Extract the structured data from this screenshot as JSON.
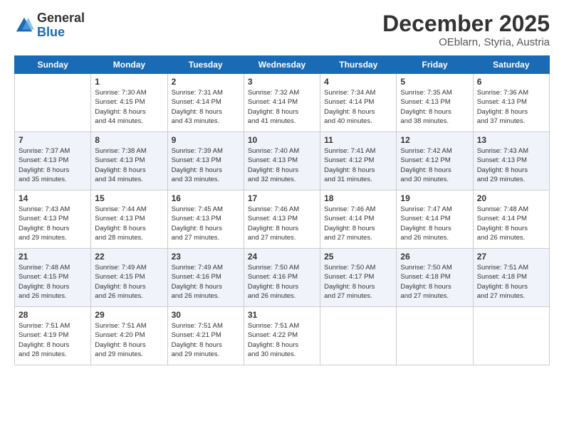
{
  "logo": {
    "general": "General",
    "blue": "Blue"
  },
  "header": {
    "month": "December 2025",
    "location": "OEblarn, Styria, Austria"
  },
  "weekdays": [
    "Sunday",
    "Monday",
    "Tuesday",
    "Wednesday",
    "Thursday",
    "Friday",
    "Saturday"
  ],
  "weeks": [
    [
      {
        "day": "",
        "info": ""
      },
      {
        "day": "1",
        "info": "Sunrise: 7:30 AM\nSunset: 4:15 PM\nDaylight: 8 hours\nand 44 minutes."
      },
      {
        "day": "2",
        "info": "Sunrise: 7:31 AM\nSunset: 4:14 PM\nDaylight: 8 hours\nand 43 minutes."
      },
      {
        "day": "3",
        "info": "Sunrise: 7:32 AM\nSunset: 4:14 PM\nDaylight: 8 hours\nand 41 minutes."
      },
      {
        "day": "4",
        "info": "Sunrise: 7:34 AM\nSunset: 4:14 PM\nDaylight: 8 hours\nand 40 minutes."
      },
      {
        "day": "5",
        "info": "Sunrise: 7:35 AM\nSunset: 4:13 PM\nDaylight: 8 hours\nand 38 minutes."
      },
      {
        "day": "6",
        "info": "Sunrise: 7:36 AM\nSunset: 4:13 PM\nDaylight: 8 hours\nand 37 minutes."
      }
    ],
    [
      {
        "day": "7",
        "info": "Sunrise: 7:37 AM\nSunset: 4:13 PM\nDaylight: 8 hours\nand 35 minutes."
      },
      {
        "day": "8",
        "info": "Sunrise: 7:38 AM\nSunset: 4:13 PM\nDaylight: 8 hours\nand 34 minutes."
      },
      {
        "day": "9",
        "info": "Sunrise: 7:39 AM\nSunset: 4:13 PM\nDaylight: 8 hours\nand 33 minutes."
      },
      {
        "day": "10",
        "info": "Sunrise: 7:40 AM\nSunset: 4:13 PM\nDaylight: 8 hours\nand 32 minutes."
      },
      {
        "day": "11",
        "info": "Sunrise: 7:41 AM\nSunset: 4:12 PM\nDaylight: 8 hours\nand 31 minutes."
      },
      {
        "day": "12",
        "info": "Sunrise: 7:42 AM\nSunset: 4:12 PM\nDaylight: 8 hours\nand 30 minutes."
      },
      {
        "day": "13",
        "info": "Sunrise: 7:43 AM\nSunset: 4:13 PM\nDaylight: 8 hours\nand 29 minutes."
      }
    ],
    [
      {
        "day": "14",
        "info": "Sunrise: 7:43 AM\nSunset: 4:13 PM\nDaylight: 8 hours\nand 29 minutes."
      },
      {
        "day": "15",
        "info": "Sunrise: 7:44 AM\nSunset: 4:13 PM\nDaylight: 8 hours\nand 28 minutes."
      },
      {
        "day": "16",
        "info": "Sunrise: 7:45 AM\nSunset: 4:13 PM\nDaylight: 8 hours\nand 27 minutes."
      },
      {
        "day": "17",
        "info": "Sunrise: 7:46 AM\nSunset: 4:13 PM\nDaylight: 8 hours\nand 27 minutes."
      },
      {
        "day": "18",
        "info": "Sunrise: 7:46 AM\nSunset: 4:14 PM\nDaylight: 8 hours\nand 27 minutes."
      },
      {
        "day": "19",
        "info": "Sunrise: 7:47 AM\nSunset: 4:14 PM\nDaylight: 8 hours\nand 26 minutes."
      },
      {
        "day": "20",
        "info": "Sunrise: 7:48 AM\nSunset: 4:14 PM\nDaylight: 8 hours\nand 26 minutes."
      }
    ],
    [
      {
        "day": "21",
        "info": "Sunrise: 7:48 AM\nSunset: 4:15 PM\nDaylight: 8 hours\nand 26 minutes."
      },
      {
        "day": "22",
        "info": "Sunrise: 7:49 AM\nSunset: 4:15 PM\nDaylight: 8 hours\nand 26 minutes."
      },
      {
        "day": "23",
        "info": "Sunrise: 7:49 AM\nSunset: 4:16 PM\nDaylight: 8 hours\nand 26 minutes."
      },
      {
        "day": "24",
        "info": "Sunrise: 7:50 AM\nSunset: 4:16 PM\nDaylight: 8 hours\nand 26 minutes."
      },
      {
        "day": "25",
        "info": "Sunrise: 7:50 AM\nSunset: 4:17 PM\nDaylight: 8 hours\nand 27 minutes."
      },
      {
        "day": "26",
        "info": "Sunrise: 7:50 AM\nSunset: 4:18 PM\nDaylight: 8 hours\nand 27 minutes."
      },
      {
        "day": "27",
        "info": "Sunrise: 7:51 AM\nSunset: 4:18 PM\nDaylight: 8 hours\nand 27 minutes."
      }
    ],
    [
      {
        "day": "28",
        "info": "Sunrise: 7:51 AM\nSunset: 4:19 PM\nDaylight: 8 hours\nand 28 minutes."
      },
      {
        "day": "29",
        "info": "Sunrise: 7:51 AM\nSunset: 4:20 PM\nDaylight: 8 hours\nand 29 minutes."
      },
      {
        "day": "30",
        "info": "Sunrise: 7:51 AM\nSunset: 4:21 PM\nDaylight: 8 hours\nand 29 minutes."
      },
      {
        "day": "31",
        "info": "Sunrise: 7:51 AM\nSunset: 4:22 PM\nDaylight: 8 hours\nand 30 minutes."
      },
      {
        "day": "",
        "info": ""
      },
      {
        "day": "",
        "info": ""
      },
      {
        "day": "",
        "info": ""
      }
    ]
  ]
}
